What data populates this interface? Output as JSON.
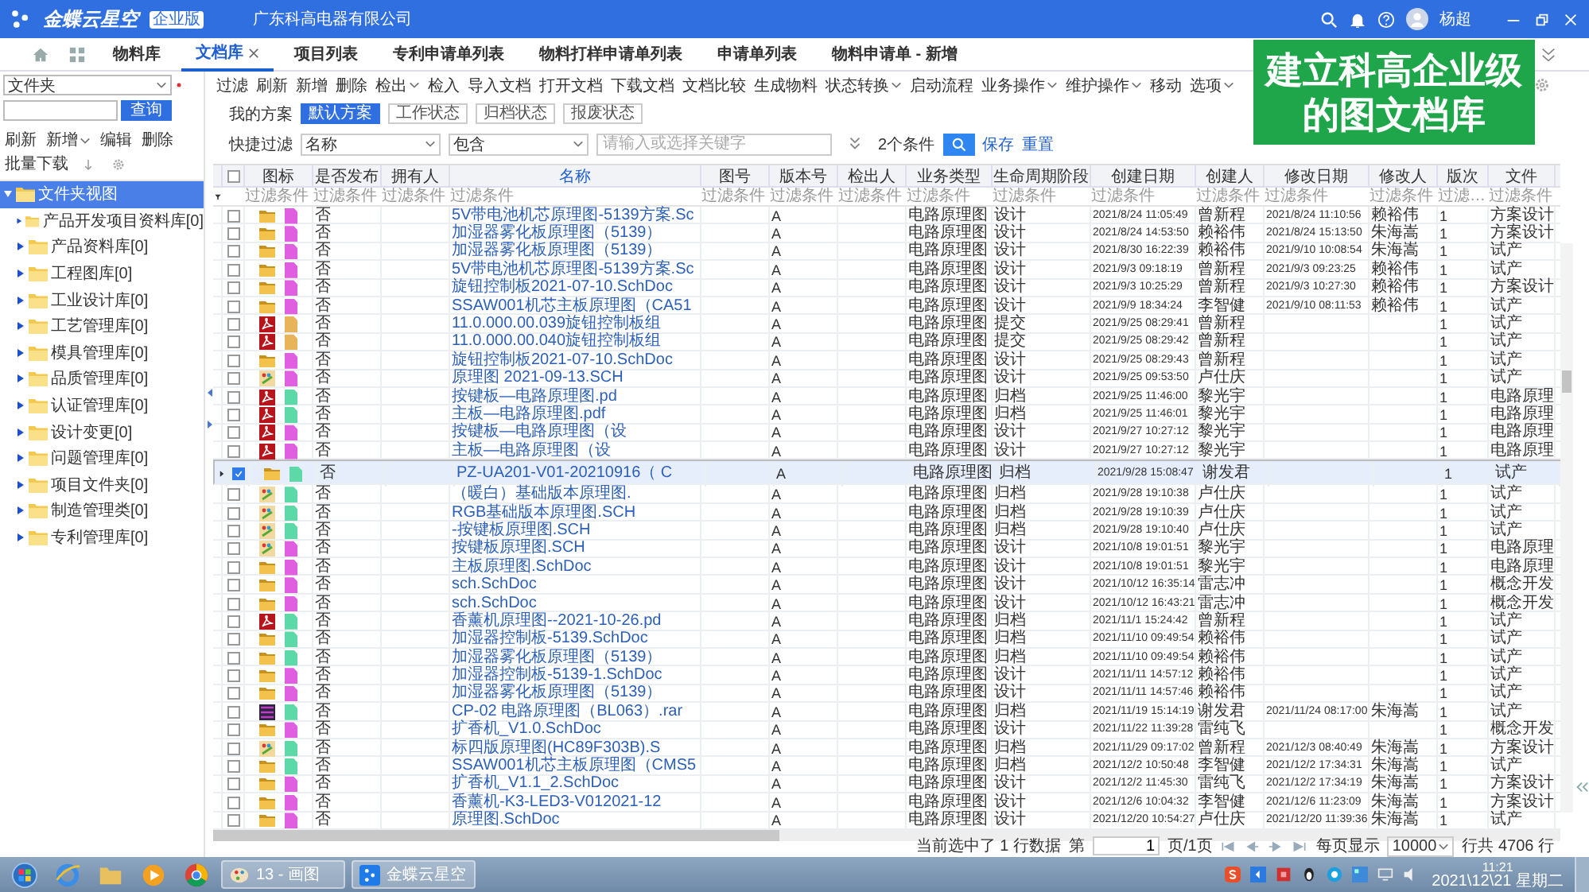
{
  "app": {
    "product": "金蝶云星空",
    "edition": "企业版",
    "company": "广东科高电器有限公司",
    "user": "杨超"
  },
  "tabs": [
    {
      "label": "物料库",
      "selected": false,
      "closable": false
    },
    {
      "label": "文档库",
      "selected": true,
      "closable": true
    },
    {
      "label": "项目列表",
      "selected": false,
      "closable": false
    },
    {
      "label": "专利申请单列表",
      "selected": false,
      "closable": false
    },
    {
      "label": "物料打样申请单列表",
      "selected": false,
      "closable": false
    },
    {
      "label": "申请单列表",
      "selected": false,
      "closable": false
    },
    {
      "label": "物料申请单 - 新增",
      "selected": false,
      "closable": false
    }
  ],
  "banner": [
    "建立科高企业级",
    "的图文档库"
  ],
  "sidebar": {
    "folder_select": "文件夹",
    "query_button": "查询",
    "toolbar": [
      {
        "label": "刷新",
        "dropdown": false
      },
      {
        "label": "新增",
        "dropdown": true
      },
      {
        "label": "编辑",
        "dropdown": false
      },
      {
        "label": "删除",
        "dropdown": false
      },
      {
        "label": "批量下载",
        "dropdown": false
      }
    ],
    "tree": {
      "label": "文件夹视图",
      "expanded": true,
      "selected": true,
      "children": [
        {
          "label": "产品开发项目资料库[0]",
          "expanded": false,
          "selected": false
        },
        {
          "label": "产品资料库[0]",
          "expanded": false,
          "selected": false
        },
        {
          "label": "工程图库[0]",
          "expanded": false,
          "selected": false
        },
        {
          "label": "工业设计库[0]",
          "expanded": false,
          "selected": false
        },
        {
          "label": "工艺管理库[0]",
          "expanded": false,
          "selected": false
        },
        {
          "label": "模具管理库[0]",
          "expanded": false,
          "selected": false
        },
        {
          "label": "品质管理库[0]",
          "expanded": false,
          "selected": false
        },
        {
          "label": "认证管理库[0]",
          "expanded": false,
          "selected": false
        },
        {
          "label": "设计变更[0]",
          "expanded": false,
          "selected": false
        },
        {
          "label": "问题管理库[0]",
          "expanded": false,
          "selected": false
        },
        {
          "label": "项目文件夹[0]",
          "expanded": false,
          "selected": false
        },
        {
          "label": "制造管理类[0]",
          "expanded": false,
          "selected": false
        },
        {
          "label": "专利管理库[0]",
          "expanded": false,
          "selected": false
        }
      ]
    }
  },
  "toolbar": [
    {
      "label": "过滤",
      "dropdown": false
    },
    {
      "label": "刷新",
      "dropdown": false
    },
    {
      "label": "新增",
      "dropdown": false
    },
    {
      "label": "删除",
      "dropdown": false
    },
    {
      "label": "检出",
      "dropdown": true
    },
    {
      "label": "检入",
      "dropdown": false
    },
    {
      "label": "导入文档",
      "dropdown": false
    },
    {
      "label": "打开文档",
      "dropdown": false
    },
    {
      "label": "下载文档",
      "dropdown": false
    },
    {
      "label": "文档比较",
      "dropdown": false
    },
    {
      "label": "生成物料",
      "dropdown": false
    },
    {
      "label": "状态转换",
      "dropdown": true
    },
    {
      "label": "启动流程",
      "dropdown": false
    },
    {
      "label": "业务操作",
      "dropdown": true
    },
    {
      "label": "维护操作",
      "dropdown": true
    },
    {
      "label": "移动",
      "dropdown": false
    },
    {
      "label": "选项",
      "dropdown": true
    }
  ],
  "schemes": {
    "label": "我的方案",
    "items": [
      {
        "label": "默认方案",
        "selected": true
      },
      {
        "label": "工作状态",
        "selected": false
      },
      {
        "label": "归档状态",
        "selected": false
      },
      {
        "label": "报废状态",
        "selected": false
      }
    ]
  },
  "quick_filter": {
    "label": "快捷过滤",
    "field": "名称",
    "operator": "包含",
    "placeholder": "请输入或选择关键字",
    "conditions": "2个条件",
    "save": "保存",
    "reset": "重置"
  },
  "table": {
    "select_all": {
      "checked": false
    },
    "columns": [
      {
        "label": "图标",
        "placeholder": "过滤条件",
        "sorted": false
      },
      {
        "label": "是否发布",
        "placeholder": "过滤条件",
        "sorted": false
      },
      {
        "label": "拥有人",
        "placeholder": "过滤条件",
        "sorted": false
      },
      {
        "label": "名称",
        "placeholder": "过滤条件",
        "sorted": true
      },
      {
        "label": "图号",
        "placeholder": "过滤条件",
        "sorted": false
      },
      {
        "label": "版本号",
        "placeholder": "过滤条件",
        "sorted": false
      },
      {
        "label": "检出人",
        "placeholder": "过滤条件",
        "sorted": false
      },
      {
        "label": "业务类型",
        "placeholder": "过滤条件",
        "sorted": false
      },
      {
        "label": "生命周期阶段",
        "placeholder": "过滤条件",
        "sorted": false
      },
      {
        "label": "创建日期",
        "placeholder": "过滤条件",
        "sorted": false
      },
      {
        "label": "创建人",
        "placeholder": "过滤条件",
        "sorted": false
      },
      {
        "label": "修改日期",
        "placeholder": "过滤条件",
        "sorted": false
      },
      {
        "label": "修改人",
        "placeholder": "过滤条件",
        "sorted": false
      },
      {
        "label": "版次",
        "placeholder": "过滤…",
        "sorted": false
      },
      {
        "label": "文件",
        "placeholder": "过滤条件",
        "sorted": false
      }
    ],
    "rows": [
      {
        "selected": false,
        "checked": false,
        "kind": "folder",
        "color": "#e05ee0",
        "published": "否",
        "name": "5V带电池机芯原理图-5139方案.Sc",
        "version": "A",
        "business_type": "电路原理图",
        "stage": "设计",
        "created": "2021/8/24 11:05:49",
        "creator": "曾新程",
        "modified": "2021/8/24 11:10:56",
        "modifier": "赖裕伟",
        "edition": "1",
        "folder": "方案设计"
      },
      {
        "selected": false,
        "checked": false,
        "kind": "folder",
        "color": "#e05ee0",
        "published": "否",
        "name": "加湿器雾化板原理图（5139）",
        "version": "A",
        "business_type": "电路原理图",
        "stage": "设计",
        "created": "2021/8/24 14:53:50",
        "creator": "赖裕伟",
        "modified": "2021/8/24 15:13:50",
        "modifier": "朱海嵩",
        "edition": "1",
        "folder": "方案设计"
      },
      {
        "selected": false,
        "checked": false,
        "kind": "folder",
        "color": "#e05ee0",
        "published": "否",
        "name": "加湿器雾化板原理图（5139）",
        "version": "A",
        "business_type": "电路原理图",
        "stage": "设计",
        "created": "2021/8/30 16:22:39",
        "creator": "赖裕伟",
        "modified": "2021/9/10 10:08:54",
        "modifier": "朱海嵩",
        "edition": "1",
        "folder": "试产"
      },
      {
        "selected": false,
        "checked": false,
        "kind": "folder",
        "color": "#e05ee0",
        "published": "否",
        "name": "5V带电池机芯原理图-5139方案.Sc",
        "version": "A",
        "business_type": "电路原理图",
        "stage": "设计",
        "created": "2021/9/3 09:18:19",
        "creator": "曾新程",
        "modified": "2021/9/3 09:23:25",
        "modifier": "赖裕伟",
        "edition": "1",
        "folder": "试产"
      },
      {
        "selected": false,
        "checked": false,
        "kind": "folder",
        "color": "#e05ee0",
        "published": "否",
        "name": "旋钮控制板2021-07-10.SchDoc",
        "version": "A",
        "business_type": "电路原理图",
        "stage": "设计",
        "created": "2021/9/3 10:25:29",
        "creator": "曾新程",
        "modified": "2021/9/3 10:27:30",
        "modifier": "赖裕伟",
        "edition": "1",
        "folder": "方案设计"
      },
      {
        "selected": false,
        "checked": false,
        "kind": "folder",
        "color": "#e05ee0",
        "published": "否",
        "name": "SSAW001机芯主板原理图（CA51",
        "version": "A",
        "business_type": "电路原理图",
        "stage": "设计",
        "created": "2021/9/9 18:34:24",
        "creator": "李智健",
        "modified": "2021/9/10 08:11:53",
        "modifier": "赖裕伟",
        "edition": "1",
        "folder": "试产"
      },
      {
        "selected": false,
        "checked": false,
        "kind": "pdf",
        "color": "#e8b45a",
        "published": "否",
        "name": "11.0.000.00.039旋钮控制板组",
        "version": "A",
        "business_type": "电路原理图",
        "stage": "提交",
        "created": "2021/9/25 08:29:41",
        "creator": "曾新程",
        "edition": "1",
        "folder": "试产"
      },
      {
        "selected": false,
        "checked": false,
        "kind": "pdf",
        "color": "#e8b45a",
        "published": "否",
        "name": "11.0.000.00.040旋钮控制板组",
        "version": "A",
        "business_type": "电路原理图",
        "stage": "提交",
        "created": "2021/9/25 08:29:42",
        "creator": "曾新程",
        "edition": "1",
        "folder": "试产"
      },
      {
        "selected": false,
        "checked": false,
        "kind": "folder",
        "color": "#e05ee0",
        "published": "否",
        "name": "旋钮控制板2021-07-10.SchDoc",
        "version": "A",
        "business_type": "电路原理图",
        "stage": "设计",
        "created": "2021/9/25 08:29:43",
        "creator": "曾新程",
        "edition": "1",
        "folder": "试产"
      },
      {
        "selected": false,
        "checked": false,
        "kind": "sch",
        "color": "#e05ee0",
        "published": "否",
        "name": "原理图 2021-09-13.SCH",
        "version": "A",
        "business_type": "电路原理图",
        "stage": "设计",
        "created": "2021/9/25 09:53:50",
        "creator": "卢仕庆",
        "edition": "1",
        "folder": "试产"
      },
      {
        "selected": false,
        "checked": false,
        "kind": "pdf",
        "color": "#5cd9a6",
        "published": "否",
        "name": "按键板—电路原理图.pd",
        "version": "A",
        "business_type": "电路原理图",
        "stage": "归档",
        "created": "2021/9/25 11:46:00",
        "creator": "黎光宇",
        "edition": "1",
        "folder": "电路原理"
      },
      {
        "selected": false,
        "checked": false,
        "kind": "pdf",
        "color": "#5cd9a6",
        "published": "否",
        "name": "主板—电路原理图.pdf",
        "version": "A",
        "business_type": "电路原理图",
        "stage": "归档",
        "created": "2021/9/25 11:46:01",
        "creator": "黎光宇",
        "edition": "1",
        "folder": "电路原理"
      },
      {
        "selected": false,
        "checked": false,
        "kind": "pdf",
        "color": "#e05ee0",
        "published": "否",
        "name": "按键板—电路原理图（设",
        "version": "A",
        "business_type": "电路原理图",
        "stage": "设计",
        "created": "2021/9/27 10:27:12",
        "creator": "黎光宇",
        "edition": "1",
        "folder": "电路原理"
      },
      {
        "selected": false,
        "checked": false,
        "kind": "pdf",
        "color": "#e05ee0",
        "published": "否",
        "name": "主板—电路原理图（设",
        "version": "A",
        "business_type": "电路原理图",
        "stage": "设计",
        "created": "2021/9/27 10:27:12",
        "creator": "黎光宇",
        "edition": "1",
        "folder": "电路原理"
      },
      {
        "selected": true,
        "checked": true,
        "kind": "folder",
        "color": "#5cd9a6",
        "published": "否",
        "name": "PZ-UA201-V01-20210916（ C",
        "version": "A",
        "business_type": "电路原理图",
        "stage": "归档",
        "created": "2021/9/28 15:08:47",
        "creator": "谢发君",
        "edition": "1",
        "folder": "试产"
      },
      {
        "selected": false,
        "checked": false,
        "kind": "sch",
        "color": "#5cd9a6",
        "published": "否",
        "name": "（暖白）基础版本原理图.",
        "version": "A",
        "business_type": "电路原理图",
        "stage": "归档",
        "created": "2021/9/28 19:10:38",
        "creator": "卢仕庆",
        "edition": "1",
        "folder": "试产"
      },
      {
        "selected": false,
        "checked": false,
        "kind": "sch",
        "color": "#5cd9a6",
        "published": "否",
        "name": "RGB基础版本原理图.SCH",
        "version": "A",
        "business_type": "电路原理图",
        "stage": "归档",
        "created": "2021/9/28 19:10:39",
        "creator": "卢仕庆",
        "edition": "1",
        "folder": "试产"
      },
      {
        "selected": false,
        "checked": false,
        "kind": "sch",
        "color": "#5cd9a6",
        "published": "否",
        "name": "-按键板原理图.SCH",
        "version": "A",
        "business_type": "电路原理图",
        "stage": "归档",
        "created": "2021/9/28 19:10:40",
        "creator": "卢仕庆",
        "edition": "1",
        "folder": "试产"
      },
      {
        "selected": false,
        "checked": false,
        "kind": "sch",
        "color": "#e05ee0",
        "published": "否",
        "name": "按键板原理图.SCH",
        "version": "A",
        "business_type": "电路原理图",
        "stage": "设计",
        "created": "2021/10/8 19:01:51",
        "creator": "黎光宇",
        "edition": "1",
        "folder": "电路原理"
      },
      {
        "selected": false,
        "checked": false,
        "kind": "folder",
        "color": "#e05ee0",
        "published": "否",
        "name": "主板原理图.SchDoc",
        "version": "A",
        "business_type": "电路原理图",
        "stage": "设计",
        "created": "2021/10/8 19:01:51",
        "creator": "黎光宇",
        "edition": "1",
        "folder": "电路原理"
      },
      {
        "selected": false,
        "checked": false,
        "kind": "folder",
        "color": "#e05ee0",
        "published": "否",
        "name": "sch.SchDoc",
        "version": "A",
        "business_type": "电路原理图",
        "stage": "设计",
        "created": "2021/10/12 16:35:14",
        "creator": "雷志冲",
        "edition": "1",
        "folder": "概念开发"
      },
      {
        "selected": false,
        "checked": false,
        "kind": "folder",
        "color": "#e05ee0",
        "published": "否",
        "name": "sch.SchDoc",
        "version": "A",
        "business_type": "电路原理图",
        "stage": "设计",
        "created": "2021/10/12 16:43:21",
        "creator": "雷志冲",
        "edition": "1",
        "folder": "概念开发"
      },
      {
        "selected": false,
        "checked": false,
        "kind": "pdf",
        "color": "#5cd9a6",
        "published": "否",
        "name": "香薰机原理图--2021-10-26.pd",
        "version": "A",
        "business_type": "电路原理图",
        "stage": "归档",
        "created": "2021/11/1 15:24:42",
        "creator": "曾新程",
        "edition": "1",
        "folder": "试产"
      },
      {
        "selected": false,
        "checked": false,
        "kind": "folder",
        "color": "#5cd9a6",
        "published": "否",
        "name": "加湿器控制板-5139.SchDoc",
        "version": "A",
        "business_type": "电路原理图",
        "stage": "归档",
        "created": "2021/11/10 09:49:54",
        "creator": "赖裕伟",
        "edition": "1",
        "folder": "试产"
      },
      {
        "selected": false,
        "checked": false,
        "kind": "folder",
        "color": "#5cd9a6",
        "published": "否",
        "name": "加湿器雾化板原理图（5139）",
        "version": "A",
        "business_type": "电路原理图",
        "stage": "归档",
        "created": "2021/11/10 09:49:54",
        "creator": "赖裕伟",
        "edition": "1",
        "folder": "试产"
      },
      {
        "selected": false,
        "checked": false,
        "kind": "folder",
        "color": "#e05ee0",
        "published": "否",
        "name": "加湿器控制板-5139-1.SchDoc",
        "version": "A",
        "business_type": "电路原理图",
        "stage": "设计",
        "created": "2021/11/11 14:57:12",
        "creator": "赖裕伟",
        "edition": "1",
        "folder": "试产"
      },
      {
        "selected": false,
        "checked": false,
        "kind": "folder",
        "color": "#e05ee0",
        "published": "否",
        "name": "加湿器雾化板原理图（5139）",
        "version": "A",
        "business_type": "电路原理图",
        "stage": "设计",
        "created": "2021/11/11 14:57:46",
        "creator": "赖裕伟",
        "edition": "1",
        "folder": "试产"
      },
      {
        "selected": false,
        "checked": false,
        "kind": "rar",
        "color": "#5cd9a6",
        "published": "否",
        "name": "CP-02 电路原理图（BL063）.rar",
        "version": "A",
        "business_type": "电路原理图",
        "stage": "归档",
        "created": "2021/11/19 15:14:19",
        "creator": "谢发君",
        "modified": "2021/11/24 08:17:00",
        "modifier": "朱海嵩",
        "edition": "1",
        "folder": "试产"
      },
      {
        "selected": false,
        "checked": false,
        "kind": "folder",
        "color": "#e05ee0",
        "published": "否",
        "name": "扩香机_V1.0.SchDoc",
        "version": "A",
        "business_type": "电路原理图",
        "stage": "设计",
        "created": "2021/11/22 11:39:28",
        "creator": "雷纯飞",
        "edition": "1",
        "folder": "概念开发"
      },
      {
        "selected": false,
        "checked": false,
        "kind": "sch",
        "color": "#5cd9a6",
        "published": "否",
        "name": "标四版原理图(HC89F303B).S",
        "version": "A",
        "business_type": "电路原理图",
        "stage": "归档",
        "created": "2021/11/29 09:17:02",
        "creator": "曾新程",
        "modified": "2021/12/3 08:40:49",
        "modifier": "朱海嵩",
        "edition": "1",
        "folder": "方案设计"
      },
      {
        "selected": false,
        "checked": false,
        "kind": "folder",
        "color": "#5cd9a6",
        "published": "否",
        "name": "SSAW001机芯主板原理图（CMS5",
        "version": "A",
        "business_type": "电路原理图",
        "stage": "归档",
        "created": "2021/12/2 10:50:48",
        "creator": "李智健",
        "modified": "2021/12/2 17:34:31",
        "modifier": "朱海嵩",
        "edition": "1",
        "folder": "试产"
      },
      {
        "selected": false,
        "checked": false,
        "kind": "folder",
        "color": "#e05ee0",
        "published": "否",
        "name": "扩香机_V1.1_2.SchDoc",
        "version": "A",
        "business_type": "电路原理图",
        "stage": "设计",
        "created": "2021/12/2 11:45:30",
        "creator": "雷纯飞",
        "modified": "2021/12/2 17:34:19",
        "modifier": "朱海嵩",
        "edition": "1",
        "folder": "方案设计"
      },
      {
        "selected": false,
        "checked": false,
        "kind": "folder",
        "color": "#e05ee0",
        "published": "否",
        "name": "香薰机-K3-LED3-V012021-12",
        "version": "A",
        "business_type": "电路原理图",
        "stage": "设计",
        "created": "2021/12/6 10:04:32",
        "creator": "李智健",
        "modified": "2021/12/6 11:23:09",
        "modifier": "朱海嵩",
        "edition": "1",
        "folder": "方案设计"
      },
      {
        "selected": false,
        "checked": false,
        "kind": "folder",
        "color": "#e05ee0",
        "published": "否",
        "name": "原理图.SchDoc",
        "version": "A",
        "business_type": "电路原理图",
        "stage": "设计",
        "created": "2021/12/20 10:54:27",
        "creator": "卢仕庆",
        "modified": "2021/12/20 11:39:36",
        "modifier": "朱海嵩",
        "edition": "1",
        "folder": "试产"
      }
    ]
  },
  "pager": {
    "status": "当前选中了 1 行数据",
    "page_label": "第",
    "page": "1",
    "page_total": "页/1页",
    "per_page_label": "每页显示",
    "per_page": "10000",
    "total": "行共 4706 行"
  },
  "taskbar": {
    "tasks": [
      {
        "label": "13 - 画图",
        "kind": "paint"
      },
      {
        "label": "金蝶云星空",
        "kind": "app"
      }
    ],
    "time": "11:21",
    "date": "2021\\12\\21 星期二"
  }
}
